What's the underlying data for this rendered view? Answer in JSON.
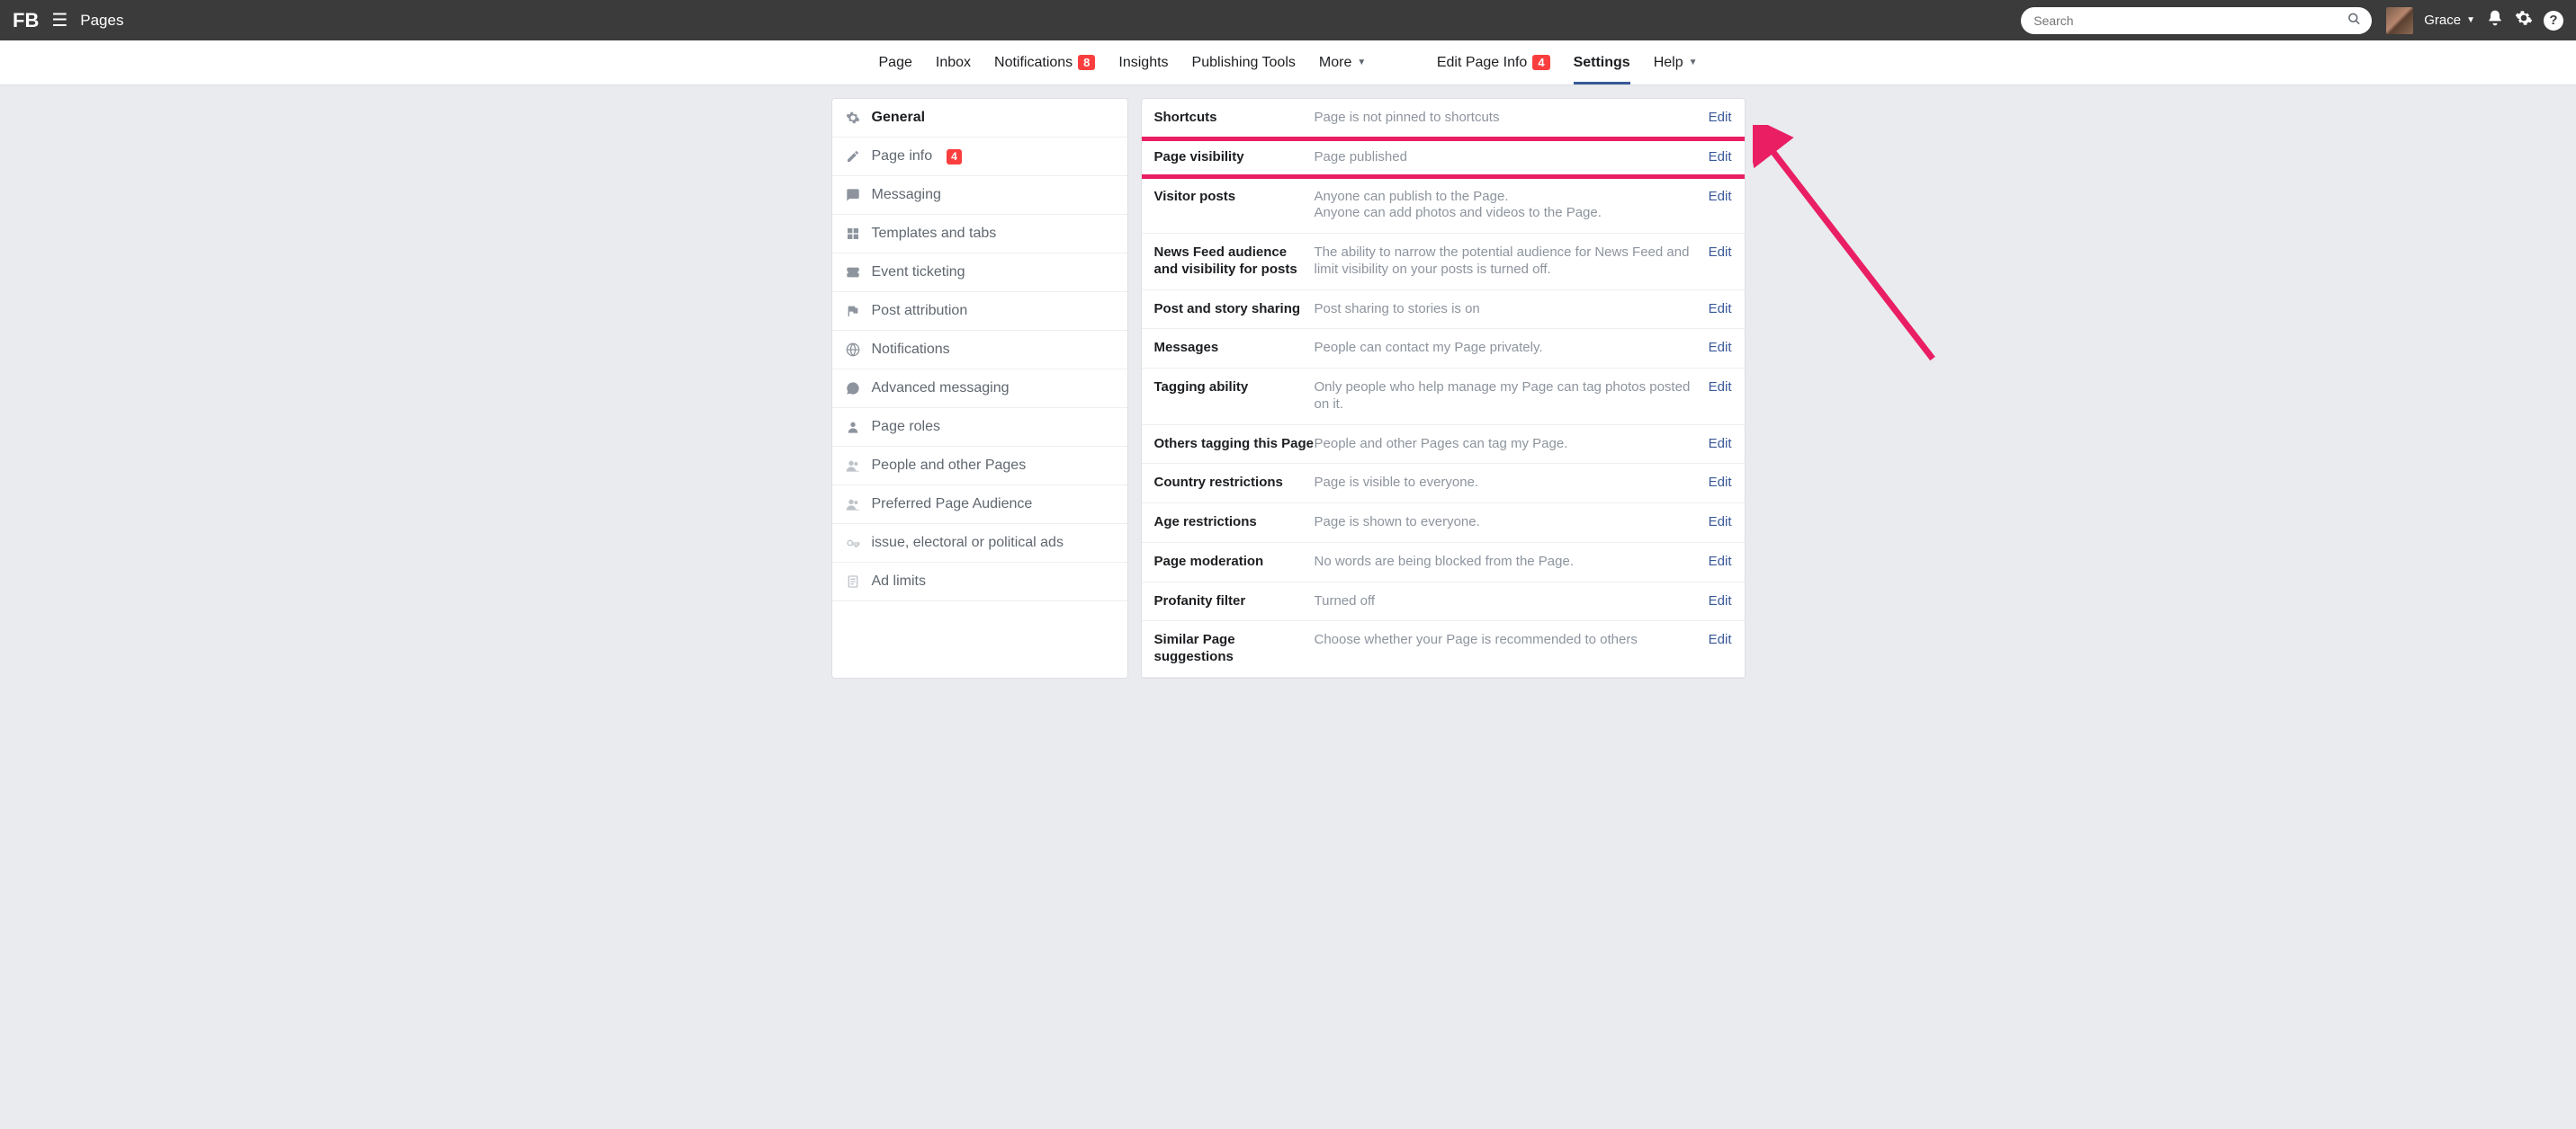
{
  "topbar": {
    "logo_text": "FB",
    "app_title": "Pages",
    "search_placeholder": "Search",
    "username": "Grace"
  },
  "secnav": {
    "left": [
      {
        "label": "Page",
        "badge": null
      },
      {
        "label": "Inbox",
        "badge": null
      },
      {
        "label": "Notifications",
        "badge": "8"
      },
      {
        "label": "Insights",
        "badge": null
      },
      {
        "label": "Publishing Tools",
        "badge": null
      },
      {
        "label": "More",
        "badge": null,
        "has_caret": true
      }
    ],
    "right": [
      {
        "label": "Edit Page Info",
        "badge": "4"
      },
      {
        "label": "Settings",
        "active": true
      },
      {
        "label": "Help",
        "has_caret": true
      }
    ]
  },
  "sidebar": {
    "items": [
      {
        "label": "General",
        "icon": "gear",
        "active": true
      },
      {
        "label": "Page info",
        "icon": "pencil",
        "badge": "4"
      },
      {
        "label": "Messaging",
        "icon": "chat"
      },
      {
        "label": "Templates and tabs",
        "icon": "grid"
      },
      {
        "label": "Event ticketing",
        "icon": "ticket"
      },
      {
        "label": "Post attribution",
        "icon": "flag"
      },
      {
        "label": "Notifications",
        "icon": "globe"
      },
      {
        "label": "Advanced messaging",
        "icon": "chat-dots"
      },
      {
        "label": "Page roles",
        "icon": "person"
      },
      {
        "label": "People and other Pages",
        "icon": "people",
        "light": true
      },
      {
        "label": "Preferred Page Audience",
        "icon": "people",
        "light": true
      },
      {
        "label": "issue, electoral or political ads",
        "icon": "key",
        "light": true
      },
      {
        "label": "Ad limits",
        "icon": "doc",
        "light": true
      }
    ]
  },
  "settings": {
    "rows": [
      {
        "label": "Shortcuts",
        "desc": "Page is not pinned to shortcuts",
        "edit": "Edit"
      },
      {
        "label": "Page visibility",
        "desc": "Page published",
        "edit": "Edit",
        "highlighted": true
      },
      {
        "label": "Visitor posts",
        "desc": "Anyone can publish to the Page.\nAnyone can add photos and videos to the Page.",
        "edit": "Edit"
      },
      {
        "label": "News Feed audience and visibility for posts",
        "desc": "The ability to narrow the potential audience for News Feed and limit visibility on your posts is turned off.",
        "edit": "Edit"
      },
      {
        "label": "Post and story sharing",
        "desc": "Post sharing to stories is on",
        "edit": "Edit"
      },
      {
        "label": "Messages",
        "desc": "People can contact my Page privately.",
        "edit": "Edit"
      },
      {
        "label": "Tagging ability",
        "desc": "Only people who help manage my Page can tag photos posted on it.",
        "edit": "Edit"
      },
      {
        "label": "Others tagging this Page",
        "desc": "People and other Pages can tag my Page.",
        "edit": "Edit"
      },
      {
        "label": "Country restrictions",
        "desc": "Page is visible to everyone.",
        "edit": "Edit"
      },
      {
        "label": "Age restrictions",
        "desc": "Page is shown to everyone.",
        "edit": "Edit"
      },
      {
        "label": "Page moderation",
        "desc": "No words are being blocked from the Page.",
        "edit": "Edit"
      },
      {
        "label": "Profanity filter",
        "desc": "Turned off",
        "edit": "Edit"
      },
      {
        "label": "Similar Page suggestions",
        "desc": "Choose whether your Page is recommended to others",
        "edit": "Edit"
      }
    ]
  }
}
